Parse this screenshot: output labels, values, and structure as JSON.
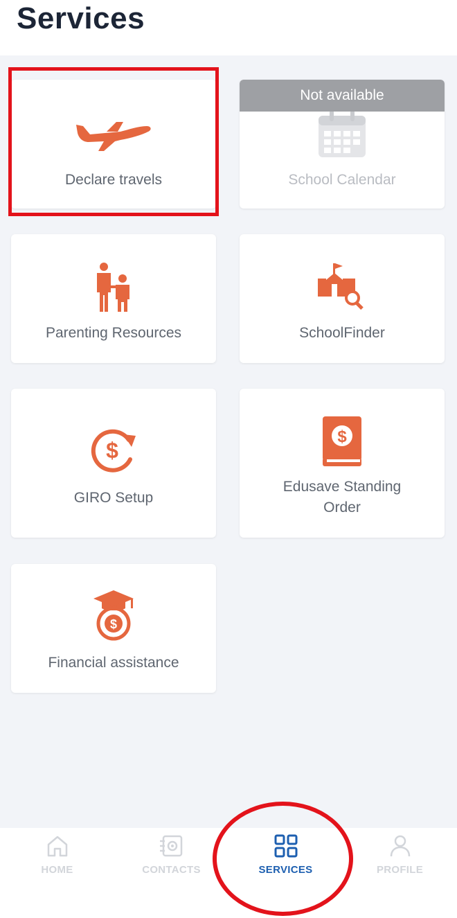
{
  "header": {
    "title": "Services"
  },
  "services": [
    {
      "label": "Declare travels",
      "icon": "airplane-icon"
    },
    {
      "label": "School Calendar",
      "icon": "calendar-icon",
      "badge": "Not available"
    },
    {
      "label": "Parenting Resources",
      "icon": "parent-child-icon"
    },
    {
      "label": "SchoolFinder",
      "icon": "school-search-icon"
    },
    {
      "label": "GIRO Setup",
      "icon": "recurring-dollar-icon"
    },
    {
      "label_lines": [
        "Edusave Standing",
        "Order"
      ],
      "icon": "dollar-book-icon"
    },
    {
      "label": "Financial assistance",
      "icon": "graduation-money-bag-icon"
    }
  ],
  "tabbar": {
    "items": [
      {
        "label": "HOME",
        "icon": "home-icon",
        "active": false
      },
      {
        "label": "CONTACTS",
        "icon": "contacts-icon",
        "active": false
      },
      {
        "label": "SERVICES",
        "icon": "grid-icon",
        "active": true
      },
      {
        "label": "PROFILE",
        "icon": "person-icon",
        "active": false
      }
    ]
  },
  "colors": {
    "accent_icon": "#e5673f",
    "active_tab": "#1d5fb0",
    "inactive_tab": "#d2d5da",
    "annotation_red": "#e3131b",
    "background": "#f2f4f8"
  }
}
